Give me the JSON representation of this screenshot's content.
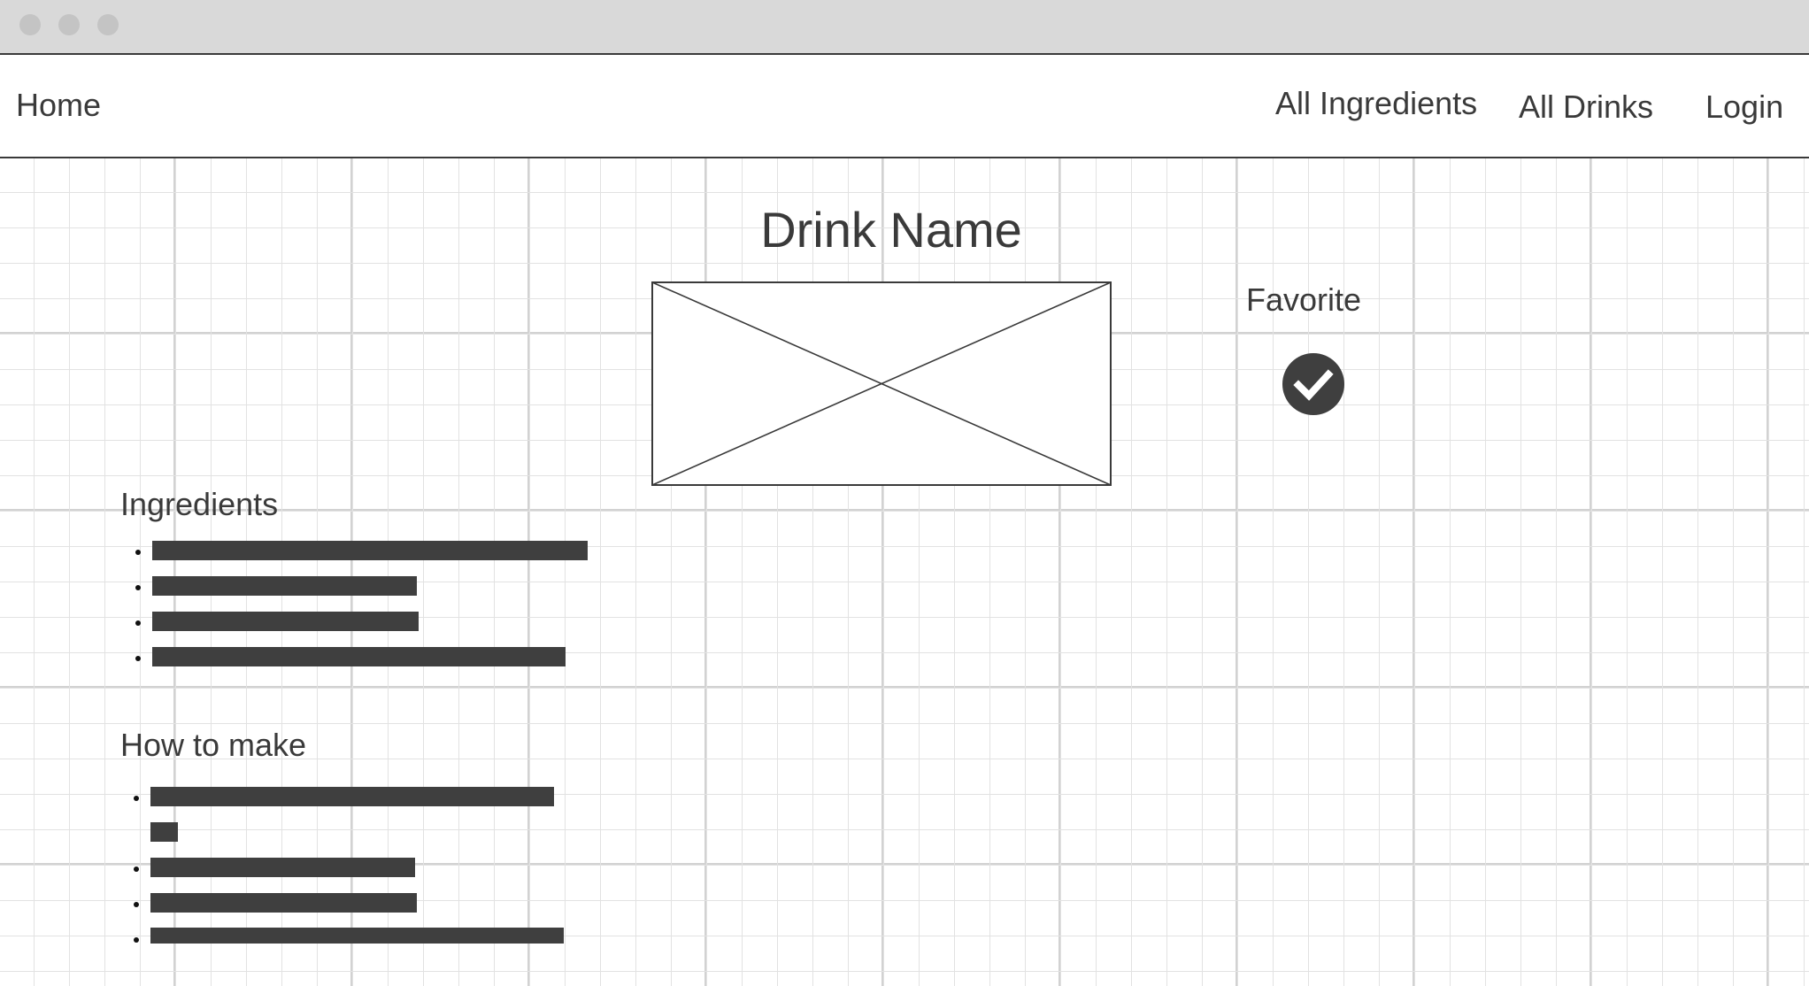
{
  "window": {
    "controls": [
      "close-dot",
      "minimize-dot",
      "maximize-dot"
    ]
  },
  "nav": {
    "home": "Home",
    "all_ingredients": "All Ingredients",
    "all_drinks": "All Drinks",
    "login": "Login"
  },
  "drink": {
    "title": "Drink Name",
    "image_icon": "image-placeholder-icon"
  },
  "favorite": {
    "label": "Favorite",
    "icon": "check-circle-icon",
    "checked": true,
    "icon_color": "#3f3f3f"
  },
  "ingredients": {
    "heading": "Ingredients",
    "items": [
      "",
      "",
      "",
      ""
    ]
  },
  "how_to_make": {
    "heading": "How to make",
    "steps": [
      "",
      "",
      "",
      ""
    ]
  },
  "colors": {
    "text": "#3a3a3a",
    "placeholder_bar": "#3f3f3f",
    "titlebar": "#d9d9d9",
    "grid": "#e2e2e2"
  }
}
